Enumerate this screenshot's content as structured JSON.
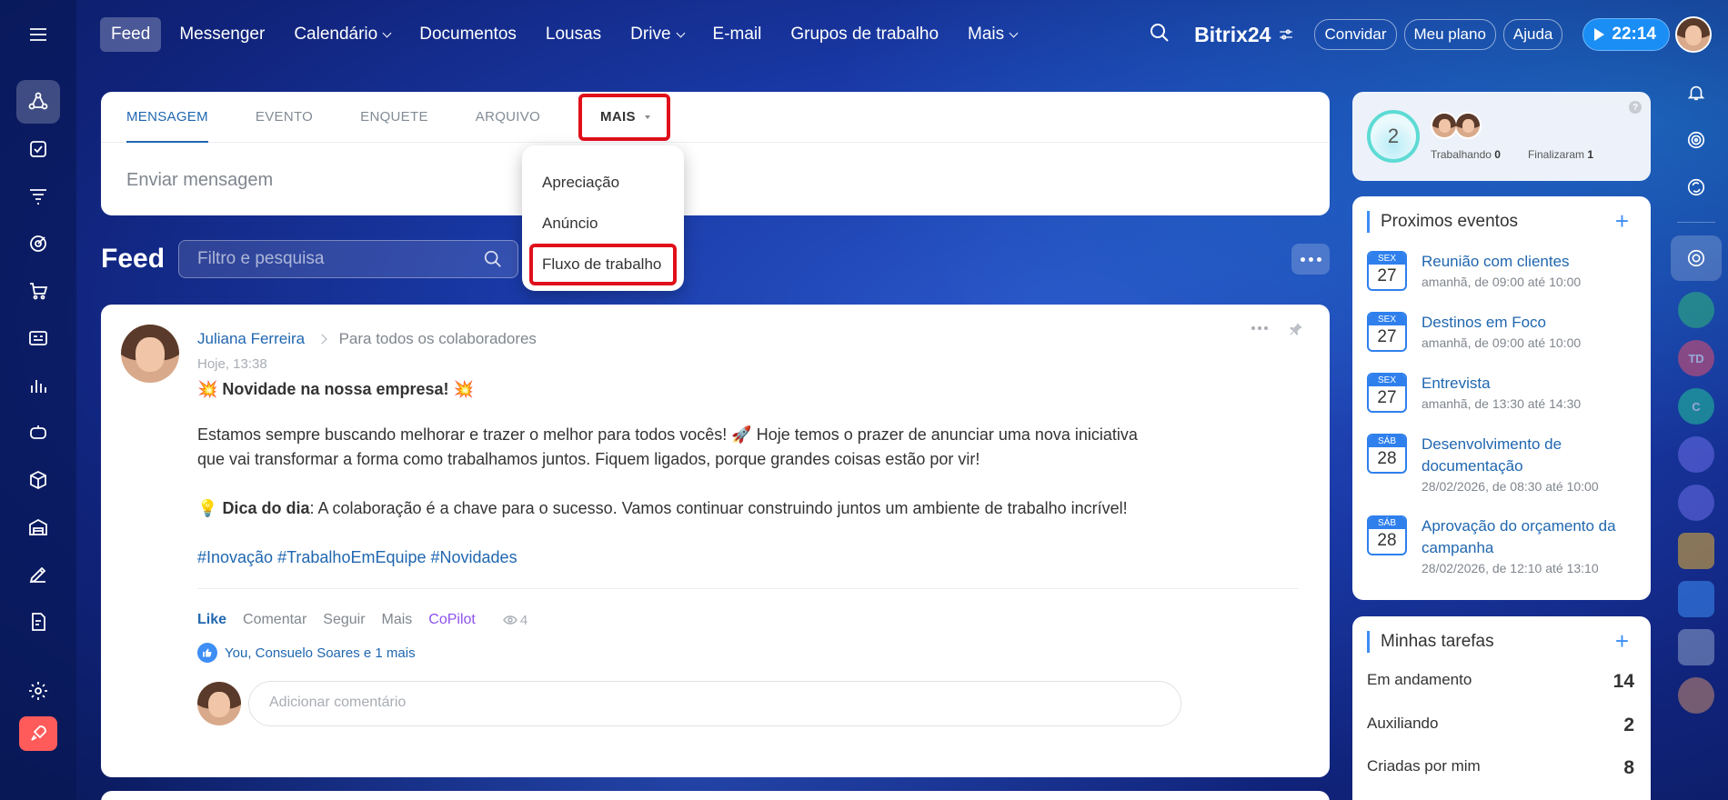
{
  "nav": {
    "items": [
      {
        "label": "Feed",
        "active": true,
        "dropdown": false
      },
      {
        "label": "Messenger",
        "active": false,
        "dropdown": false
      },
      {
        "label": "Calendário",
        "active": false,
        "dropdown": true
      },
      {
        "label": "Documentos",
        "active": false,
        "dropdown": false
      },
      {
        "label": "Lousas",
        "active": false,
        "dropdown": false
      },
      {
        "label": "Drive",
        "active": false,
        "dropdown": true
      },
      {
        "label": "E-mail",
        "active": false,
        "dropdown": false
      },
      {
        "label": "Grupos de trabalho",
        "active": false,
        "dropdown": false
      },
      {
        "label": "Mais",
        "active": false,
        "dropdown": true
      }
    ]
  },
  "header": {
    "brand": "Bitrix24",
    "invite_label": "Convidar",
    "plan_label": "Meu plano",
    "help_label": "Ajuda",
    "timer": "22:14"
  },
  "composer": {
    "tabs": [
      "MENSAGEM",
      "EVENTO",
      "ENQUETE",
      "ARQUIVO"
    ],
    "more_label": "MAIS",
    "placeholder": "Enviar mensagem"
  },
  "dropdown": {
    "items": [
      "Apreciação",
      "Anúncio",
      "Fluxo de trabalho"
    ]
  },
  "feed": {
    "title": "Feed",
    "search_placeholder": "Filtro e pesquisa"
  },
  "post": {
    "author": "Juliana Ferreira",
    "recipients": "Para todos os colaboradores",
    "time": "Hoje, 13:38",
    "title": "💥 Novidade na nossa empresa! 💥",
    "paragraph1": "Estamos sempre buscando melhorar e trazer o melhor para todos vocês! 🚀 Hoje temos o prazer de anunciar uma nova iniciativa que vai transformar a forma como trabalhamos juntos. Fiquem ligados, porque grandes coisas estão por vir!",
    "tip_icon": "💡",
    "tip_label": "Dica do dia",
    "tip_text": ": A colaboração é a chave para o sucesso. Vamos continuar construindo juntos um ambiente de trabalho incrível!",
    "hashtags": "#Inovação #TrabalhoEmEquipe #Novidades",
    "actions": {
      "like": "Like",
      "comment": "Comentar",
      "follow": "Seguir",
      "more": "Mais",
      "copilot": "CoPilot",
      "views": "4"
    },
    "likes_text": "You, Consuelo Soares e 1 mais",
    "comment_placeholder": "Adicionar comentário"
  },
  "worktime": {
    "count": "2",
    "working_label": "Trabalhando",
    "working_value": "0",
    "finished_label": "Finalizaram",
    "finished_value": "1",
    "help": "?"
  },
  "events": {
    "title": "Proximos eventos",
    "plus": "+",
    "items": [
      {
        "dow": "SEX",
        "day": "27",
        "title": "Reunião com clientes",
        "time": "amanhã, de 09:00 até 10:00"
      },
      {
        "dow": "SEX",
        "day": "27",
        "title": "Destinos em Foco",
        "time": "amanhã, de 09:00 até 10:00"
      },
      {
        "dow": "SEX",
        "day": "27",
        "title": "Entrevista",
        "time": "amanhã, de 13:30 até 14:30"
      },
      {
        "dow": "SÁB",
        "day": "28",
        "title": "Desenvolvimento de documentação",
        "time": "28/02/2026, de 08:30 até 10:00"
      },
      {
        "dow": "SÁB",
        "day": "28",
        "title": "Aprovação do orçamento da campanha",
        "time": "28/02/2026, de 12:10 até 13:10"
      }
    ]
  },
  "tasks": {
    "title": "Minhas tarefas",
    "plus": "+",
    "items": [
      {
        "label": "Em andamento",
        "count": "14"
      },
      {
        "label": "Auxiliando",
        "count": "2"
      },
      {
        "label": "Criadas por mim",
        "count": "8"
      }
    ]
  },
  "right_bar": {
    "chat_initials": "TD",
    "chat_letter": "C"
  },
  "colors": {
    "accent": "#2067b0",
    "highlight_border": "#e0101a",
    "timer_bg": "#1b8ef5",
    "copilot": "#8e52ec"
  }
}
